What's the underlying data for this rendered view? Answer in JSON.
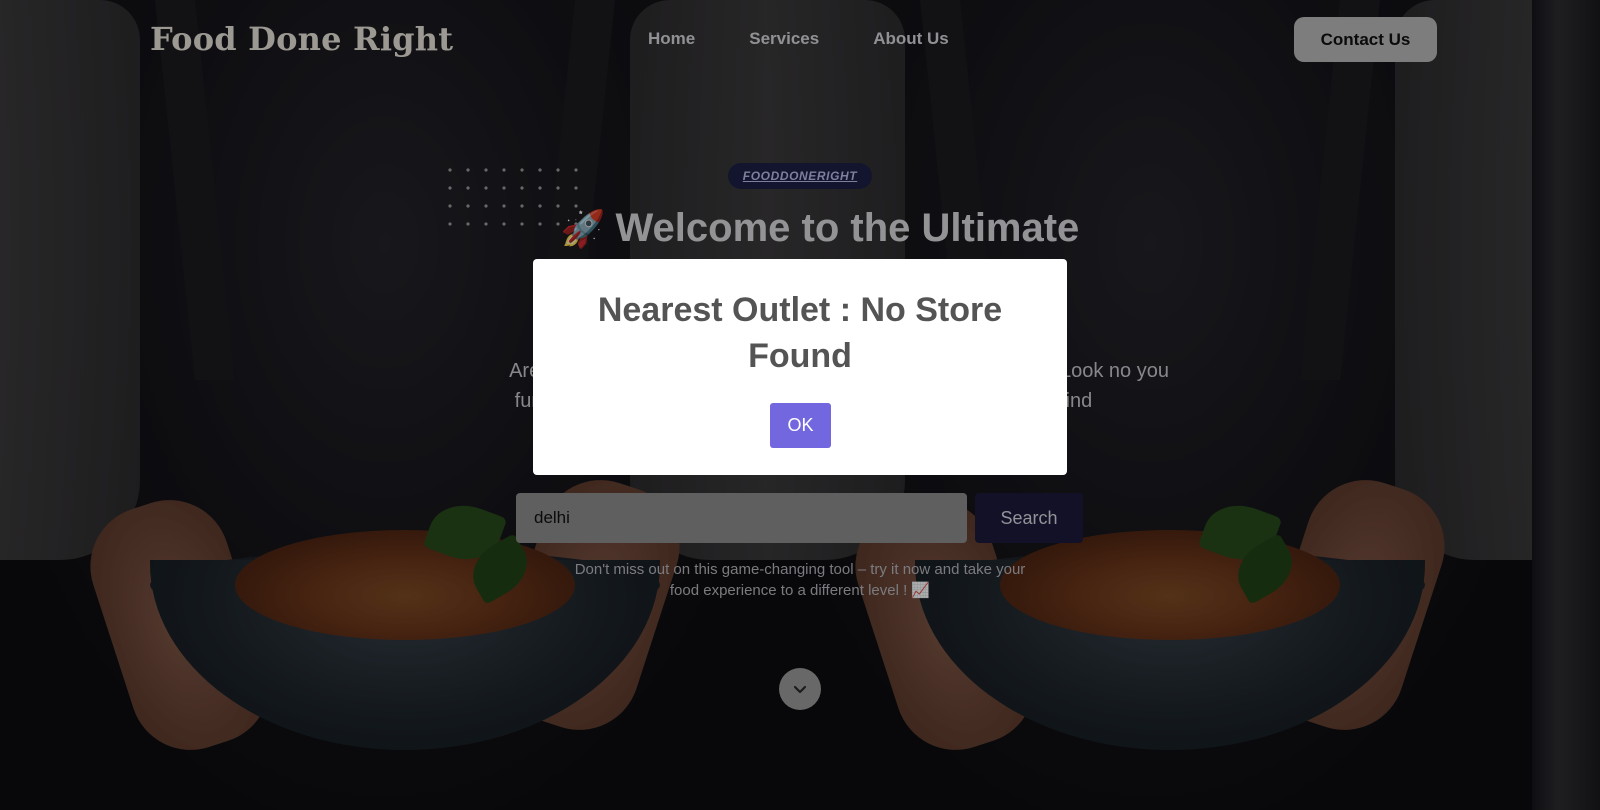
{
  "brand": {
    "logo_text": "Food Done Right"
  },
  "nav": {
    "links": [
      {
        "label": "Home"
      },
      {
        "label": "Services"
      },
      {
        "label": "About Us"
      }
    ],
    "contact_label": "Contact Us"
  },
  "hero": {
    "badge": "FOODDONERIGHT",
    "title": "Welcome to the Ultimate",
    "desc_left": "Are you further!",
    "desc_right": "Look no you find",
    "search": {
      "value": "delhi",
      "button_label": "Search"
    },
    "subtext": "Don't miss out on this game-changing tool – try it now and take your food experience to a different level ! 📈"
  },
  "modal": {
    "title": "Nearest Outlet : No Store Found",
    "ok_label": "OK"
  },
  "colors": {
    "modal_ok": "#7367df",
    "search_button": "#1b1a3a",
    "badge_bg": "#1d1f45"
  },
  "icons": {
    "rocket": "rocket-icon",
    "scroll": "chevron-down-icon"
  }
}
